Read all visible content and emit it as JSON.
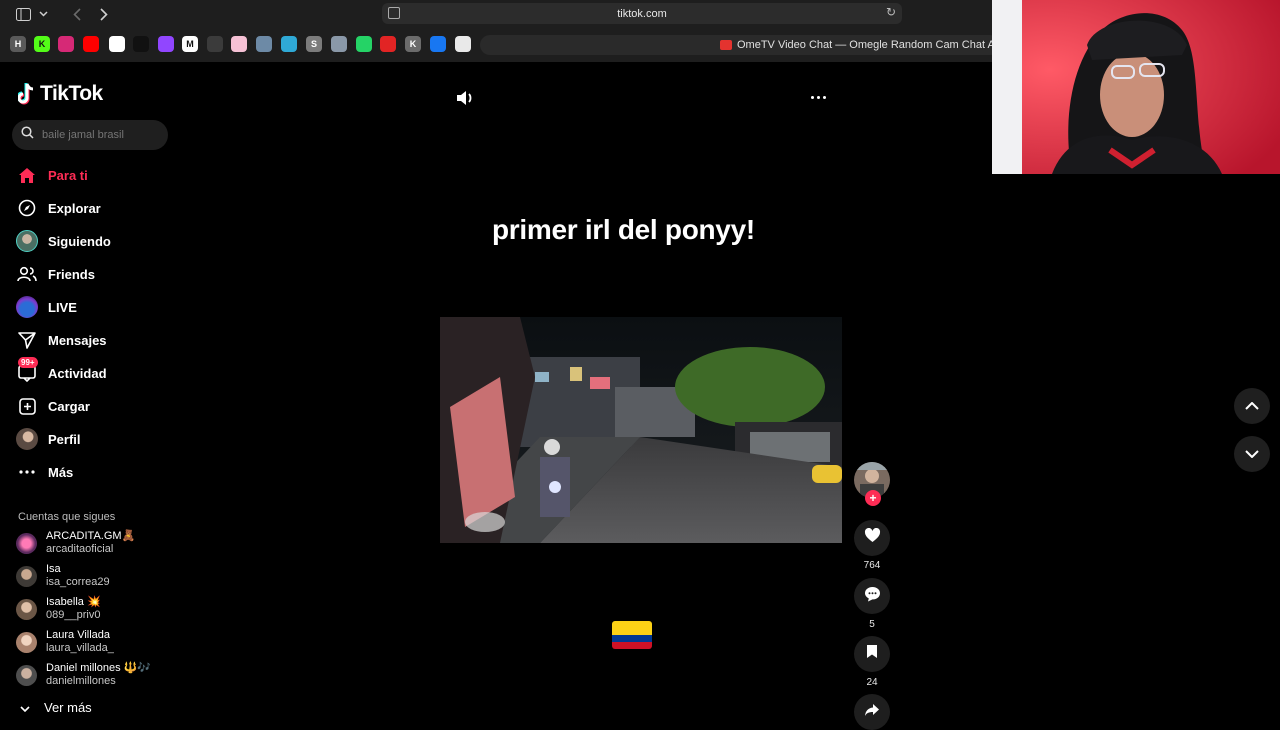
{
  "browser": {
    "url": "tiktok.com",
    "active_tab_title": "OmeTV Video Chat — Omegle Random Cam Chat Alterna",
    "bookmarks": [
      {
        "icon": "h-icon",
        "label": "H",
        "color": "#5a5a5a"
      },
      {
        "icon": "kick-icon",
        "label": "K",
        "color": "#53fc18"
      },
      {
        "icon": "instagram-icon",
        "label": "",
        "color": "#d62976"
      },
      {
        "icon": "youtube-icon",
        "label": "",
        "color": "#ff0000"
      },
      {
        "icon": "shield-app-icon",
        "label": "",
        "color": "#ffffff"
      },
      {
        "icon": "tiktok-icon",
        "label": "",
        "color": "#111111"
      },
      {
        "icon": "twitch-icon",
        "label": "",
        "color": "#9146ff"
      },
      {
        "icon": "medium-icon",
        "label": "M",
        "color": "#ffffff"
      },
      {
        "icon": "bolt-icon",
        "label": "",
        "color": "#3b3b3b"
      },
      {
        "icon": "app-pink-icon",
        "label": "",
        "color": "#f6c1d5"
      },
      {
        "icon": "image-icon",
        "label": "",
        "color": "#6d8aa6"
      },
      {
        "icon": "cube-icon",
        "label": "",
        "color": "#2fa9d6"
      },
      {
        "icon": "s-icon",
        "label": "S",
        "color": "#7c7c7c"
      },
      {
        "icon": "photo-icon",
        "label": "",
        "color": "#8a98a8"
      },
      {
        "icon": "whatsapp-icon",
        "label": "",
        "color": "#25d366"
      },
      {
        "icon": "red-app-icon",
        "label": "",
        "color": "#e22424"
      },
      {
        "icon": "k-icon",
        "label": "K",
        "color": "#6b6b6b"
      },
      {
        "icon": "meta-icon",
        "label": "",
        "color": "#1877f2"
      },
      {
        "icon": "openai-icon",
        "label": "",
        "color": "#e9e9e9"
      }
    ]
  },
  "sidebar": {
    "logo": "TikTok",
    "search_placeholder": "baile jamal brasil",
    "nav": [
      {
        "name": "nav-para-ti",
        "label": "Para ti",
        "active": true
      },
      {
        "name": "nav-explorar",
        "label": "Explorar"
      },
      {
        "name": "nav-siguiendo",
        "label": "Siguiendo"
      },
      {
        "name": "nav-friends",
        "label": "Friends"
      },
      {
        "name": "nav-live",
        "label": "LIVE"
      },
      {
        "name": "nav-mensajes",
        "label": "Mensajes"
      },
      {
        "name": "nav-actividad",
        "label": "Actividad",
        "badge": "99+"
      },
      {
        "name": "nav-cargar",
        "label": "Cargar"
      },
      {
        "name": "nav-perfil",
        "label": "Perfil"
      },
      {
        "name": "nav-mas",
        "label": "Más"
      }
    ],
    "following_header": "Cuentas que sigues",
    "following": [
      {
        "name": "ARCADITA.GM🧸",
        "username": "arcaditaoficial"
      },
      {
        "name": "Isa",
        "username": "isa_correa29"
      },
      {
        "name": "Isabella 💥",
        "username": "089__priv0"
      },
      {
        "name": "Laura Villada",
        "username": "laura_villada_"
      },
      {
        "name": "Daniel millones 🔱🎶",
        "username": "danielmillones"
      }
    ],
    "see_more": "Ver más"
  },
  "video": {
    "title": "primer irl del ponyy!",
    "likes": "764",
    "comments": "5",
    "saves": "24"
  },
  "colors": {
    "accent": "#fe2c55",
    "background": "#000000",
    "panel": "#1e1e1e"
  }
}
